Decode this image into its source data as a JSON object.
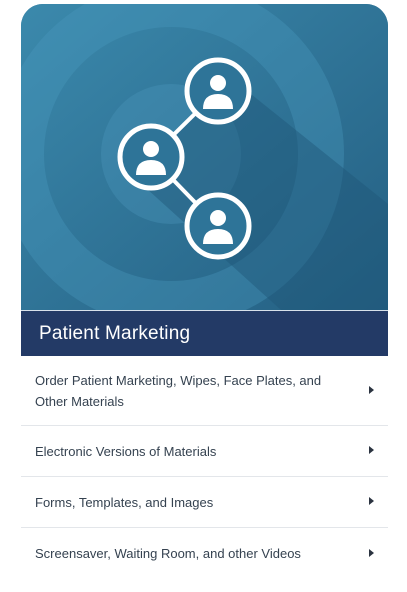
{
  "card": {
    "icon": "share-network-icon",
    "title": "Patient Marketing",
    "colors": {
      "hero": "#2f7396",
      "title_bar": "#233a66"
    }
  },
  "menu": {
    "items": [
      {
        "label": "Order Patient Marketing, Wipes, Face Plates, and Other Materials",
        "icon": "chevron-right-icon"
      },
      {
        "label": "Electronic Versions of Materials",
        "icon": "chevron-right-icon"
      },
      {
        "label": "Forms, Templates, and Images",
        "icon": "chevron-right-icon"
      },
      {
        "label": "Screensaver, Waiting Room, and other Videos",
        "icon": "chevron-right-icon"
      }
    ]
  }
}
